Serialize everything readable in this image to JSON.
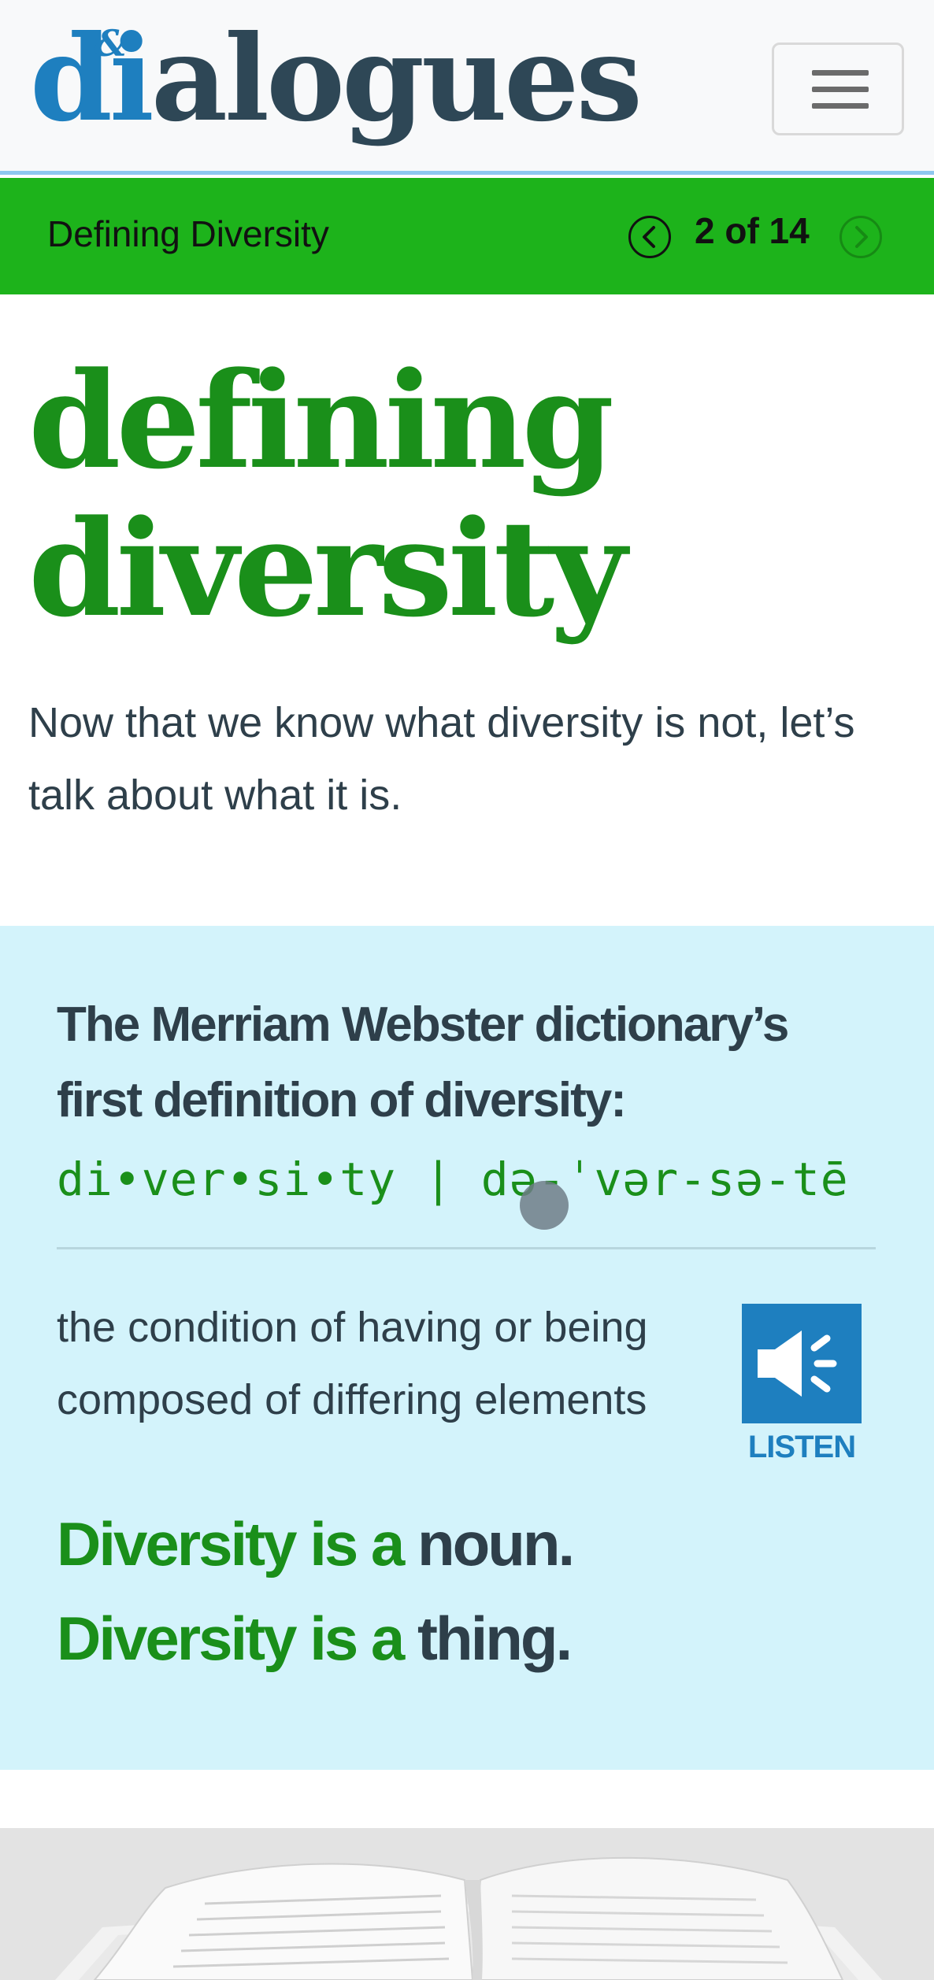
{
  "header": {
    "logo_di": "di",
    "logo_rest": "alogues",
    "logo_amp": "&",
    "menu_icon": "hamburger-menu-icon"
  },
  "progress": {
    "section_title": "Defining Diversity",
    "page_count": "2 of 14",
    "prev_icon": "chevron-left-icon",
    "next_icon": "chevron-right-icon",
    "bar_color": "#1db31b"
  },
  "main": {
    "heading_line1": "defining",
    "heading_line2": "diversity",
    "intro": "Now that we know what diversity is not, let’s talk about what it is."
  },
  "definition": {
    "heading": "The Merriam Webster dictionary’s first definition of diversity:",
    "pronunciation": "di•ver•si•ty | də-ˈvər-sə-tē",
    "text": "the condition of having or being composed of differing elements",
    "listen_icon": "speaker-icon",
    "listen_label": "LISTEN",
    "pos1_green": "Diversity is a",
    "pos1_dark": "noun.",
    "pos2_green": "Diversity is a",
    "pos2_dark": "thing.",
    "panel_color": "#d3f3fb"
  },
  "image": {
    "subject": "open-book-image"
  },
  "colors": {
    "brand_blue": "#1e7fbf",
    "brand_green": "#1a8f1a",
    "text_dark": "#2e3f4a"
  }
}
